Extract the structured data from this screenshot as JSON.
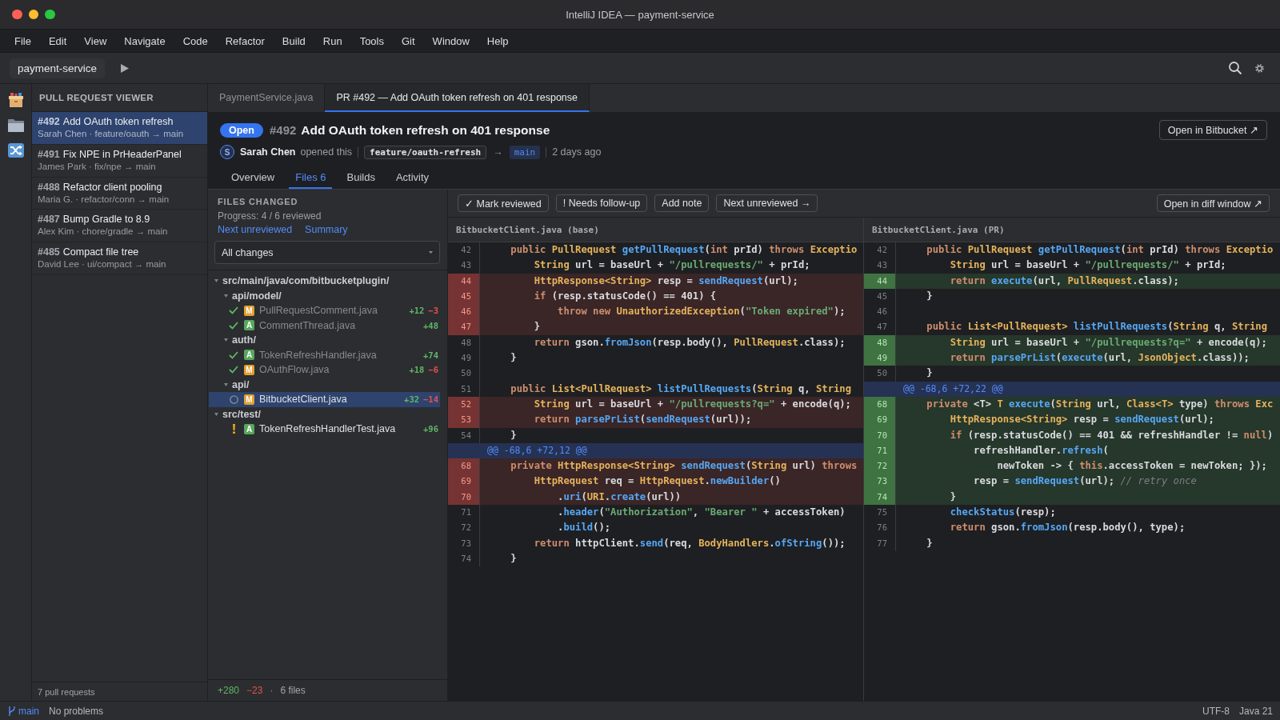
{
  "window": {
    "title": "IntelliJ IDEA — payment-service"
  },
  "menu": [
    "File",
    "Edit",
    "View",
    "Navigate",
    "Code",
    "Refactor",
    "Build",
    "Run",
    "Tools",
    "Git",
    "Window",
    "Help"
  ],
  "toolbar": {
    "project": "payment-service"
  },
  "sidebar": {
    "title": "PULL REQUEST VIEWER",
    "items": [
      {
        "number": "#492",
        "title": "Add OAuth token refresh",
        "meta": "Sarah Chen · feature/oauth → main",
        "selected": true
      },
      {
        "number": "#491",
        "title": "Fix NPE in PrHeaderPanel",
        "meta": "James Park · fix/npe → main",
        "selected": false
      },
      {
        "number": "#488",
        "title": "Refactor client pooling",
        "meta": "Maria G. · refactor/conn → main",
        "selected": false
      },
      {
        "number": "#487",
        "title": "Bump Gradle to 8.9",
        "meta": "Alex Kim · chore/gradle → main",
        "selected": false
      },
      {
        "number": "#485",
        "title": "Compact file tree",
        "meta": "David Lee · ui/compact → main",
        "selected": false
      }
    ],
    "footer": "7 pull requests"
  },
  "editor_tabs": [
    {
      "label": "PaymentService.java",
      "selected": false
    },
    {
      "label": "PR #492 — Add OAuth token refresh on 401 response",
      "selected": true
    }
  ],
  "pull_request": {
    "status": "Open",
    "number": "#492",
    "title": "Add OAuth token refresh on 401 response",
    "open_button": "Open in Bitbucket ↗",
    "author_initial": "S",
    "author": "Sarah Chen",
    "action": "opened this",
    "source_branch": "feature/oauth-refresh",
    "arrow": "→",
    "target_branch": "main",
    "age": "2 days ago",
    "tabs": [
      {
        "label": "Overview",
        "selected": false
      },
      {
        "label": "Files 6",
        "selected": true
      },
      {
        "label": "Builds",
        "selected": false
      },
      {
        "label": "Activity",
        "selected": false
      }
    ]
  },
  "files_panel": {
    "heading": "FILES CHANGED",
    "progress": "Progress: 4 / 6 reviewed",
    "links": [
      "Next unreviewed",
      "Summary"
    ],
    "filter": "All changes",
    "tree": [
      {
        "kind": "folder",
        "name": "src/main/java/com/bitbucketplugin/",
        "expanded": true,
        "selected": false,
        "children": [
          {
            "kind": "folder",
            "name": "api/model/",
            "expanded": true,
            "selected": false,
            "children": [
              {
                "kind": "file",
                "badge": "M",
                "color": "#e2a032",
                "name": "PullRequestComment.java",
                "additions": "+12",
                "deletions": "−3",
                "reviewed": true,
                "flagged": false,
                "selected": false
              },
              {
                "kind": "file",
                "badge": "A",
                "color": "#57a85c",
                "name": "CommentThread.java",
                "additions": "+48",
                "reviewed": true,
                "flagged": false,
                "selected": false
              }
            ]
          },
          {
            "kind": "folder",
            "name": "auth/",
            "expanded": true,
            "selected": false,
            "children": [
              {
                "kind": "file",
                "badge": "A",
                "color": "#57a85c",
                "name": "TokenRefreshHandler.java",
                "additions": "+74",
                "reviewed": true,
                "flagged": false,
                "selected": false
              },
              {
                "kind": "file",
                "badge": "M",
                "color": "#e2a032",
                "name": "OAuthFlow.java",
                "additions": "+18",
                "deletions": "−6",
                "reviewed": true,
                "flagged": false,
                "selected": false
              }
            ]
          },
          {
            "kind": "folder",
            "name": "api/",
            "expanded": true,
            "selected": false,
            "children": [
              {
                "kind": "file",
                "badge": "M",
                "color": "#e2a032",
                "name": "BitbucketClient.java",
                "additions": "+32",
                "deletions": "−14",
                "reviewed": false,
                "flagged": false,
                "selected": true
              }
            ]
          }
        ]
      },
      {
        "kind": "folder",
        "name": "src/test/",
        "expanded": true,
        "selected": false,
        "children": [
          {
            "kind": "file",
            "badge": "A",
            "color": "#57a85c",
            "name": "TokenRefreshHandlerTest.java",
            "additions": "+96",
            "reviewed": false,
            "flagged": true,
            "selected": false
          }
        ]
      }
    ],
    "summary": {
      "additions": "+280",
      "deletions": "−23",
      "separator": "·",
      "files": "6 files"
    }
  },
  "diff": {
    "actions": [
      "✓ Mark reviewed",
      "! Needs follow-up",
      "Add note",
      "Next unreviewed →"
    ],
    "open_button": "Open in diff window ↗",
    "panes": [
      {
        "title": "BitbucketClient.java (base)",
        "rows": [
          {
            "kind": "context",
            "number": "42",
            "code": [
              {
                "kind": "keyword",
                "text": "    public "
              },
              {
                "kind": "type",
                "text": "PullRequest "
              },
              {
                "kind": "method",
                "text": "getPullRequest"
              },
              "(",
              {
                "kind": "keyword",
                "text": "int "
              },
              "prId) ",
              {
                "kind": "keyword",
                "text": "throws "
              },
              {
                "kind": "type",
                "text": "Exceptio"
              }
            ]
          },
          {
            "kind": "context",
            "number": "43",
            "code": [
              {
                "kind": "type",
                "text": "        String "
              },
              "url = baseUrl + ",
              {
                "kind": "string",
                "text": "\"/pullrequests/\""
              },
              " + prId;"
            ]
          },
          {
            "kind": "removed",
            "number": "44",
            "code": [
              {
                "kind": "type",
                "text": "        HttpResponse<String> "
              },
              "resp = ",
              {
                "kind": "method",
                "text": "sendRequest"
              },
              "(url);"
            ]
          },
          {
            "kind": "removed",
            "number": "45",
            "code": [
              {
                "kind": "keyword",
                "text": "        if "
              },
              "(resp.statusCode() == 401) {"
            ]
          },
          {
            "kind": "removed",
            "number": "46",
            "code": [
              {
                "kind": "keyword",
                "text": "            throw new "
              },
              {
                "kind": "type",
                "text": "UnauthorizedException"
              },
              "(",
              {
                "kind": "string",
                "text": "\"Token expired\""
              },
              ");"
            ]
          },
          {
            "kind": "removed",
            "number": "47",
            "code": [
              "        }"
            ]
          },
          {
            "kind": "context",
            "number": "48",
            "code": [
              {
                "kind": "keyword",
                "text": "        return "
              },
              "gson.",
              {
                "kind": "method",
                "text": "fromJson"
              },
              "(resp.body(), ",
              {
                "kind": "type",
                "text": "PullRequest"
              },
              ".class);"
            ]
          },
          {
            "kind": "context",
            "number": "49",
            "code": [
              "    }"
            ]
          },
          {
            "kind": "context",
            "number": "50"
          },
          {
            "kind": "context",
            "number": "51",
            "code": [
              {
                "kind": "keyword",
                "text": "    public "
              },
              {
                "kind": "type",
                "text": "List<PullRequest> "
              },
              {
                "kind": "method",
                "text": "listPullRequests"
              },
              "(",
              {
                "kind": "type",
                "text": "String "
              },
              "q, ",
              {
                "kind": "type",
                "text": "String"
              }
            ]
          },
          {
            "kind": "removed",
            "number": "52",
            "code": [
              {
                "kind": "type",
                "text": "        String "
              },
              "url = baseUrl + ",
              {
                "kind": "string",
                "text": "\"/pullrequests?q=\""
              },
              " + encode(q);"
            ]
          },
          {
            "kind": "removed",
            "number": "53",
            "code": [
              {
                "kind": "keyword",
                "text": "        return "
              },
              {
                "kind": "method",
                "text": "parsePrList"
              },
              "(",
              {
                "kind": "method",
                "text": "sendRequest"
              },
              "(url));"
            ]
          },
          {
            "kind": "context",
            "number": "54",
            "code": [
              "    }"
            ]
          },
          {
            "kind": "hunk",
            "text": "@@ -68,6 +72,12 @@"
          },
          {
            "kind": "removed",
            "number": "68",
            "code": [
              {
                "kind": "keyword",
                "text": "    private "
              },
              {
                "kind": "type",
                "text": "HttpResponse<String> "
              },
              {
                "kind": "method",
                "text": "sendRequest"
              },
              "(",
              {
                "kind": "type",
                "text": "String "
              },
              "url) ",
              {
                "kind": "keyword",
                "text": "throws"
              }
            ]
          },
          {
            "kind": "removed",
            "number": "69",
            "code": [
              {
                "kind": "type",
                "text": "        HttpRequest "
              },
              "req = ",
              {
                "kind": "type",
                "text": "HttpRequest"
              },
              ".",
              {
                "kind": "method",
                "text": "newBuilder"
              },
              "()"
            ]
          },
          {
            "kind": "removed",
            "number": "70",
            "code": [
              "            .",
              {
                "kind": "method",
                "text": "uri"
              },
              "(",
              {
                "kind": "type",
                "text": "URI"
              },
              ".",
              {
                "kind": "method",
                "text": "create"
              },
              "(url))"
            ]
          },
          {
            "kind": "context",
            "number": "71",
            "code": [
              "            .",
              {
                "kind": "method",
                "text": "header"
              },
              "(",
              {
                "kind": "string",
                "text": "\"Authorization\""
              },
              ", ",
              {
                "kind": "string",
                "text": "\"Bearer \""
              },
              " + accessToken)"
            ]
          },
          {
            "kind": "context",
            "number": "72",
            "code": [
              "            .",
              {
                "kind": "method",
                "text": "build"
              },
              "();"
            ]
          },
          {
            "kind": "context",
            "number": "73",
            "code": [
              {
                "kind": "keyword",
                "text": "        return "
              },
              "httpClient.",
              {
                "kind": "method",
                "text": "send"
              },
              "(req, ",
              {
                "kind": "type",
                "text": "BodyHandlers"
              },
              ".",
              {
                "kind": "method",
                "text": "ofString"
              },
              "());"
            ]
          },
          {
            "kind": "context",
            "number": "74",
            "code": [
              "    }"
            ]
          }
        ]
      },
      {
        "title": "BitbucketClient.java (PR)",
        "rows": [
          {
            "kind": "context",
            "number": "42",
            "code": [
              {
                "kind": "keyword",
                "text": "    public "
              },
              {
                "kind": "type",
                "text": "PullRequest "
              },
              {
                "kind": "method",
                "text": "getPullRequest"
              },
              "(",
              {
                "kind": "keyword",
                "text": "int "
              },
              "prId) ",
              {
                "kind": "keyword",
                "text": "throws "
              },
              {
                "kind": "type",
                "text": "Exceptio"
              }
            ]
          },
          {
            "kind": "context",
            "number": "43",
            "code": [
              {
                "kind": "type",
                "text": "        String "
              },
              "url = baseUrl + ",
              {
                "kind": "string",
                "text": "\"/pullrequests/\""
              },
              " + prId;"
            ]
          },
          {
            "kind": "added",
            "number": "44",
            "code": [
              {
                "kind": "keyword",
                "text": "        return "
              },
              {
                "kind": "method",
                "text": "execute"
              },
              "(url, ",
              {
                "kind": "type",
                "text": "PullRequest"
              },
              ".class);"
            ]
          },
          {
            "kind": "context",
            "number": "45",
            "code": [
              "    }"
            ]
          },
          {
            "kind": "context",
            "number": "46"
          },
          {
            "kind": "context",
            "number": "47",
            "code": [
              {
                "kind": "keyword",
                "text": "    public "
              },
              {
                "kind": "type",
                "text": "List<PullRequest> "
              },
              {
                "kind": "method",
                "text": "listPullRequests"
              },
              "(",
              {
                "kind": "type",
                "text": "String "
              },
              "q, ",
              {
                "kind": "type",
                "text": "String"
              }
            ]
          },
          {
            "kind": "added",
            "number": "48",
            "code": [
              {
                "kind": "type",
                "text": "        String "
              },
              "url = baseUrl + ",
              {
                "kind": "string",
                "text": "\"/pullrequests?q=\""
              },
              " + encode(q);"
            ]
          },
          {
            "kind": "added",
            "number": "49",
            "code": [
              {
                "kind": "keyword",
                "text": "        return "
              },
              {
                "kind": "method",
                "text": "parsePrList"
              },
              "(",
              {
                "kind": "method",
                "text": "execute"
              },
              "(url, ",
              {
                "kind": "type",
                "text": "JsonObject"
              },
              ".class));"
            ]
          },
          {
            "kind": "context",
            "number": "50",
            "code": [
              "    }"
            ]
          },
          {
            "kind": "hunk",
            "text": "@@ -68,6 +72,22 @@"
          },
          {
            "kind": "added",
            "number": "68",
            "code": [
              {
                "kind": "keyword",
                "text": "    private "
              },
              "<T> ",
              {
                "kind": "type",
                "text": "T "
              },
              {
                "kind": "method",
                "text": "execute"
              },
              "(",
              {
                "kind": "type",
                "text": "String "
              },
              "url, ",
              {
                "kind": "type",
                "text": "Class<T> "
              },
              "type) ",
              {
                "kind": "keyword",
                "text": "throws "
              },
              {
                "kind": "type",
                "text": "Exc"
              }
            ]
          },
          {
            "kind": "added",
            "number": "69",
            "code": [
              {
                "kind": "type",
                "text": "        HttpResponse<String> "
              },
              "resp = ",
              {
                "kind": "method",
                "text": "sendRequest"
              },
              "(url);"
            ]
          },
          {
            "kind": "added",
            "number": "70",
            "code": [
              {
                "kind": "keyword",
                "text": "        if "
              },
              "(resp.statusCode() == 401 && refreshHandler != ",
              {
                "kind": "keyword",
                "text": "null"
              },
              ")"
            ]
          },
          {
            "kind": "added",
            "number": "71",
            "code": [
              "            refreshHandler.",
              {
                "kind": "method",
                "text": "refresh"
              },
              "("
            ]
          },
          {
            "kind": "added",
            "number": "72",
            "code": [
              "                newToken -> { ",
              {
                "kind": "keyword",
                "text": "this"
              },
              ".accessToken = newToken; });"
            ]
          },
          {
            "kind": "added",
            "number": "73",
            "code": [
              "            resp = ",
              {
                "kind": "method",
                "text": "sendRequest"
              },
              "(url); ",
              {
                "kind": "comment",
                "text": "// retry once"
              }
            ]
          },
          {
            "kind": "added",
            "number": "74",
            "code": [
              "        }"
            ]
          },
          {
            "kind": "context",
            "number": "75",
            "code": [
              {
                "kind": "method",
                "text": "        checkStatus"
              },
              "(resp);"
            ]
          },
          {
            "kind": "context",
            "number": "76",
            "code": [
              {
                "kind": "keyword",
                "text": "        return "
              },
              "gson.",
              {
                "kind": "method",
                "text": "fromJson"
              },
              "(resp.body(), type);"
            ]
          },
          {
            "kind": "context",
            "number": "77",
            "code": [
              "    }"
            ]
          }
        ]
      }
    ]
  },
  "status_bar": {
    "branch": "main",
    "problems": "No problems",
    "encoding": "UTF-8",
    "language": "Java 21"
  }
}
